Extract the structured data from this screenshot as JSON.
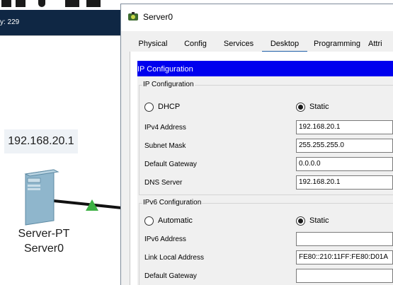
{
  "workspace": {
    "statusbar_text": "y: 229",
    "device_ip_label": "192.168.20.1",
    "device_type": "Server-PT",
    "device_name": "Server0"
  },
  "dialog": {
    "title": "Server0",
    "tabs": [
      {
        "label": "Physical",
        "active": false
      },
      {
        "label": "Config",
        "active": false
      },
      {
        "label": "Services",
        "active": false
      },
      {
        "label": "Desktop",
        "active": true
      },
      {
        "label": "Programming",
        "active": false
      },
      {
        "label": "Attri",
        "active": false
      }
    ],
    "panel_header": "IP Configuration",
    "ipv4_group": {
      "title": "IP Configuration",
      "dhcp_label": "DHCP",
      "static_label": "Static",
      "selected": "Static",
      "fields": [
        {
          "label": "IPv4 Address",
          "value": "192.168.20.1"
        },
        {
          "label": "Subnet Mask",
          "value": "255.255.255.0"
        },
        {
          "label": "Default Gateway",
          "value": "0.0.0.0"
        },
        {
          "label": "DNS Server",
          "value": "192.168.20.1"
        }
      ]
    },
    "ipv6_group": {
      "title": "IPv6 Configuration",
      "automatic_label": "Automatic",
      "static_label": "Static",
      "selected": "Static",
      "fields": [
        {
          "label": "IPv6 Address",
          "value": ""
        },
        {
          "label": "Link Local Address",
          "value": "FE80::210:11FF:FE80:D01A"
        },
        {
          "label": "Default Gateway",
          "value": ""
        }
      ]
    }
  },
  "colors": {
    "header_blue": "#0000ee",
    "workspace_bar": "#0f2744",
    "link_green": "#3cb043"
  }
}
